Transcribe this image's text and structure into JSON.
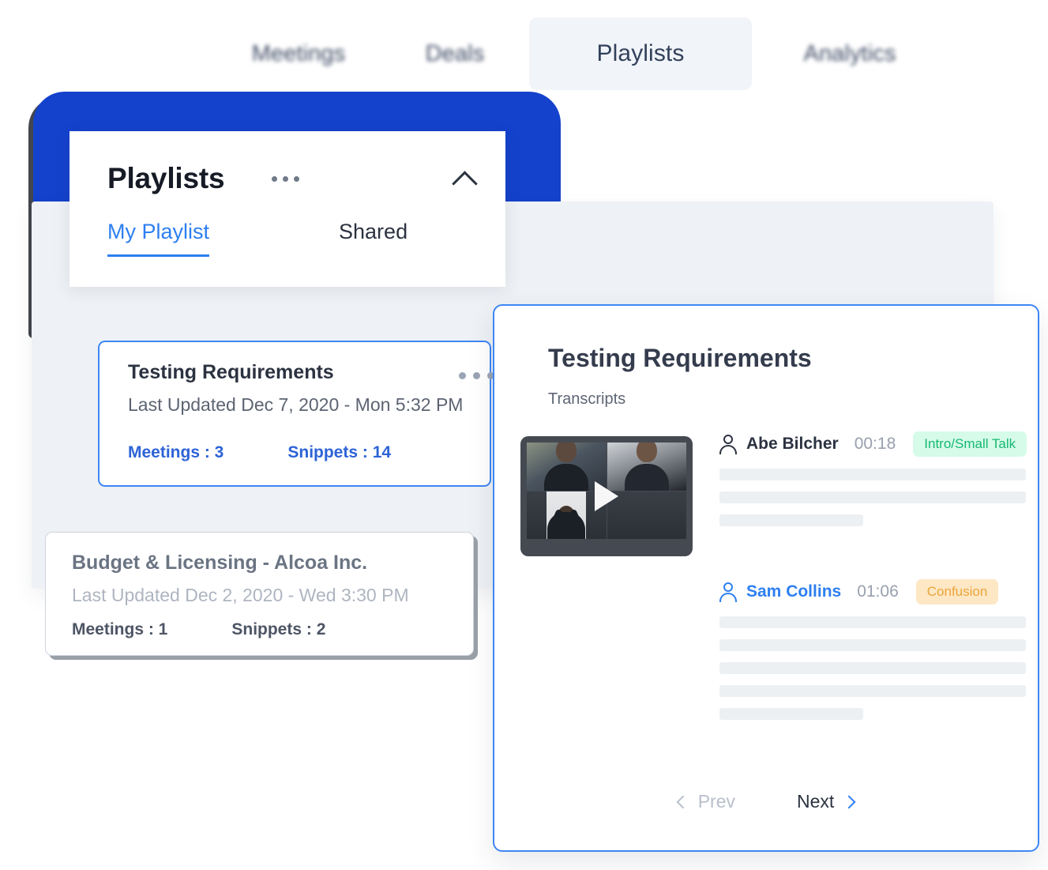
{
  "topnav": {
    "tabs": [
      {
        "label": "Meetings",
        "active": false
      },
      {
        "label": "Deals",
        "active": false
      },
      {
        "label": "Playlists",
        "active": true
      },
      {
        "label": "Analytics",
        "active": false
      }
    ]
  },
  "playlist_panel": {
    "title": "Playlists",
    "menu_icon": "ellipsis-icon",
    "collapse_icon": "chevron-up-icon",
    "tabs": [
      {
        "label": "My Playlist",
        "selected": true
      },
      {
        "label": "Shared",
        "selected": false
      }
    ],
    "cards": [
      {
        "title": "Testing Requirements",
        "subtitle": "Last Updated Dec 7, 2020 - Mon 5:32 PM",
        "meetings": "Meetings : 3",
        "snippets": "Snippets : 14",
        "selected": true
      },
      {
        "title": "Budget & Licensing - Alcoa Inc.",
        "subtitle": "Last Updated Dec 2, 2020 - Wed 3:30 PM",
        "meetings": "Meetings : 1",
        "snippets": "Snippets : 2",
        "selected": false
      }
    ]
  },
  "transcript_panel": {
    "title": "Testing Requirements",
    "subtitle": "Transcripts",
    "video": {
      "play_icon": "play-icon",
      "participants": 3
    },
    "entries": [
      {
        "speaker": "Abe Bilcher",
        "speaker_icon": "user-icon",
        "time": "00:18",
        "tag": "Intro/Small Talk",
        "tag_color": "#16b872",
        "tag_bg": "#d6fbe8",
        "skeleton_widths": [
          "100%",
          "100%",
          "47%"
        ]
      },
      {
        "speaker": "Sam Collins",
        "speaker_icon": "user-icon",
        "time": "01:06",
        "tag": "Confusion",
        "tag_color": "#eba53a",
        "tag_bg": "#fde7c4",
        "skeleton_widths": [
          "100%",
          "100%",
          "100%",
          "100%",
          "47%"
        ]
      }
    ],
    "pager": {
      "prev_label": "Prev",
      "prev_icon": "chevron-left-icon",
      "next_label": "Next",
      "next_icon": "chevron-right-icon"
    }
  },
  "colors": {
    "brand_blue": "#1442cc",
    "accent_blue": "#2d7ff0",
    "panel_grey": "#eef1f5"
  }
}
